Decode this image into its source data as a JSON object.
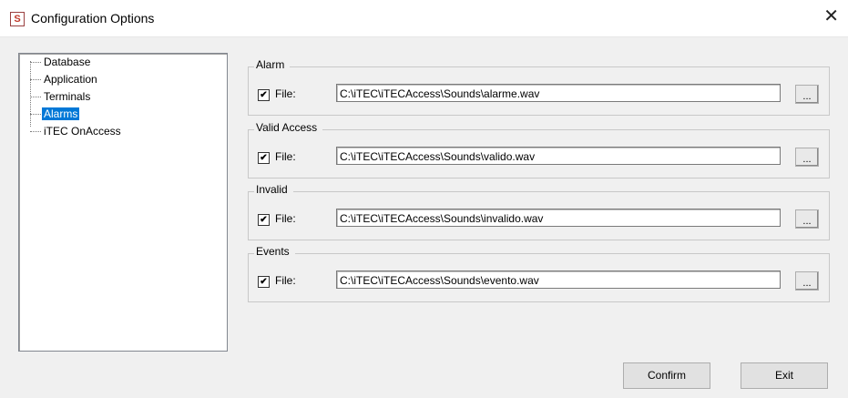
{
  "window": {
    "title": "Configuration Options",
    "close_glyph": "✕"
  },
  "tree": {
    "items": [
      {
        "label": "Database",
        "selected": false
      },
      {
        "label": "Application",
        "selected": false
      },
      {
        "label": "Terminals",
        "selected": false
      },
      {
        "label": "Alarms",
        "selected": true
      },
      {
        "label": "iTEC OnAccess",
        "selected": false
      }
    ]
  },
  "groups": [
    {
      "title": "Alarm",
      "checkbox_label": "File:",
      "checked": true,
      "path": "C:\\iTEC\\iTECAccess\\Sounds\\alarme.wav",
      "browse_label": "..."
    },
    {
      "title": "Valid Access",
      "checkbox_label": "File:",
      "checked": true,
      "path": "C:\\iTEC\\iTECAccess\\Sounds\\valido.wav",
      "browse_label": "..."
    },
    {
      "title": "Invalid",
      "checkbox_label": "File:",
      "checked": true,
      "path": "C:\\iTEC\\iTECAccess\\Sounds\\invalido.wav",
      "browse_label": "..."
    },
    {
      "title": "Events",
      "checkbox_label": "File:",
      "checked": true,
      "path": "C:\\iTEC\\iTECAccess\\Sounds\\evento.wav",
      "browse_label": "..."
    }
  ],
  "buttons": {
    "confirm": "Confirm",
    "exit": "Exit"
  },
  "icons": {
    "app": "app-logo-icon",
    "close": "close-icon",
    "check": "checkmark-icon"
  },
  "colors": {
    "selection": "#0078d7"
  }
}
